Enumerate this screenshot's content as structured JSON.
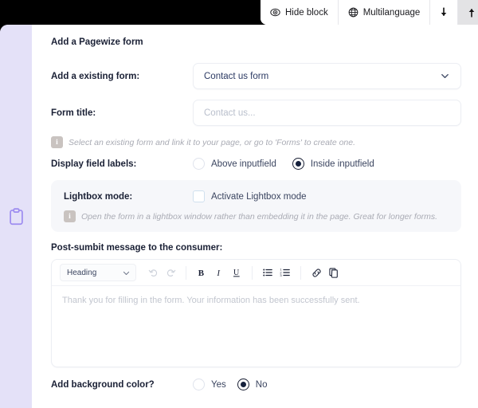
{
  "toolbar": {
    "buttons": [
      {
        "label": "Hide block",
        "icon": "eye-icon",
        "name": "hide-block-button",
        "active": false
      },
      {
        "label": "Multilanguage",
        "icon": "globe-icon",
        "name": "multilanguage-button",
        "active": false
      }
    ],
    "move_down_label": "↓",
    "move_up_label": "↑",
    "close_label": "×"
  },
  "rail": {
    "icon": "clipboard-icon"
  },
  "form": {
    "section_title": "Add a Pagewize form",
    "existing_form": {
      "label": "Add a existing form:",
      "value": "Contact us form",
      "icon": "chevron-down-icon"
    },
    "form_title": {
      "label": "Form title:",
      "value": "",
      "placeholder": "Contact us..."
    },
    "existing_form_hint": {
      "icon": "info-icon",
      "icon_glyph": "i",
      "text": "Select an existing form and link it to your page, or go to 'Forms' to create one."
    },
    "display_field_labels": {
      "label": "Display field labels:",
      "options": [
        {
          "label": "Above inputfield",
          "selected": false
        },
        {
          "label": "Inside inputfield",
          "selected": true
        }
      ]
    },
    "lightbox": {
      "label": "Lightbox mode:",
      "checkbox_label": "Activate Lightbox mode",
      "checked": false,
      "hint": {
        "icon": "info-icon",
        "icon_glyph": "i",
        "text": "Open the form in a lightbox window rather than embedding it in the page. Great for longer forms."
      }
    },
    "post_submit": {
      "label": "Post-sumbit message to the consumer:",
      "format_value": "Heading",
      "format_icon": "chevron-down-icon",
      "tools": [
        {
          "name": "undo-icon",
          "glyph": "↶",
          "dim": true
        },
        {
          "name": "redo-icon",
          "glyph": "↷",
          "dim": true
        },
        {
          "name": "bold-icon",
          "glyph": "B",
          "dim": false
        },
        {
          "name": "italic-icon",
          "glyph": "I",
          "dim": false
        },
        {
          "name": "underline-icon",
          "glyph": "U",
          "dim": false
        },
        {
          "name": "bulleted-list-icon",
          "glyph": "☰",
          "dim": false
        },
        {
          "name": "numbered-list-icon",
          "glyph": "☰",
          "dim": false
        },
        {
          "name": "link-icon",
          "glyph": "🔗",
          "dim": false
        },
        {
          "name": "paste-icon",
          "glyph": "⧉",
          "dim": false
        }
      ],
      "body_text": "Thank you for filling in the form. Your information has been successfully sent."
    },
    "background_color": {
      "label": "Add background color?",
      "options": [
        {
          "label": "Yes",
          "selected": false
        },
        {
          "label": "No",
          "selected": true
        }
      ]
    }
  },
  "colors": {
    "rail_bg": "#e4e1f8",
    "rail_icon": "#9d8cf0",
    "radio_selected": "#15203c",
    "select_text": "#2c3a63",
    "card_bg": "#f6f7fa",
    "info_icon_bg": "#c9c3c0"
  }
}
